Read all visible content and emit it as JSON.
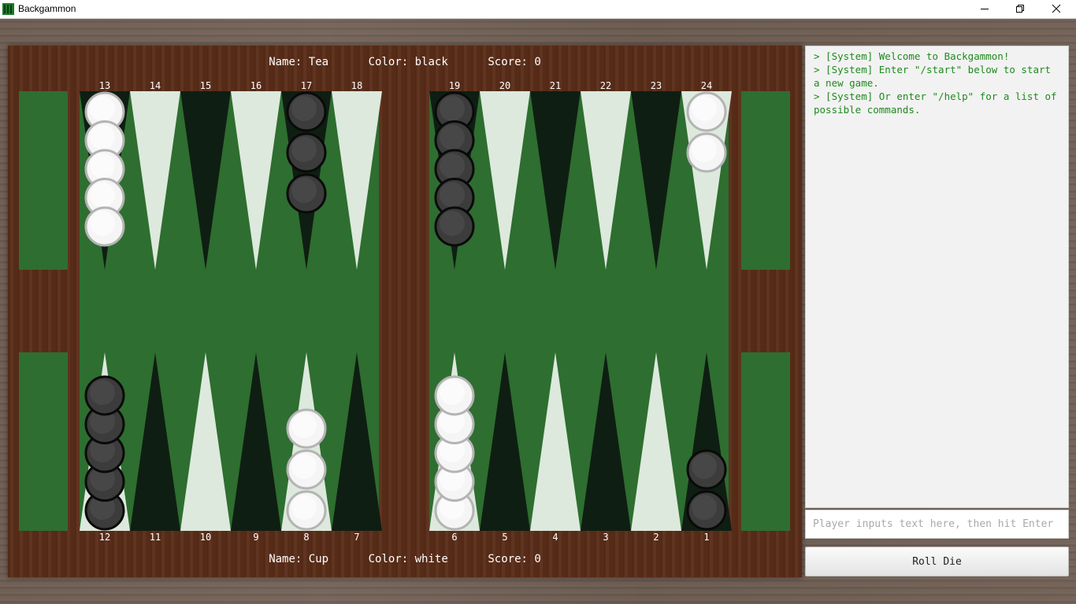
{
  "window": {
    "title": "Backgammon",
    "controls": [
      "minimize-icon",
      "restore-icon",
      "close-icon"
    ]
  },
  "players": {
    "top": {
      "name_text": "Name: Tea",
      "color_text": "Color: black",
      "score_text": "Score: 0"
    },
    "bottom": {
      "name_text": "Name: Cup",
      "color_text": "Color: white",
      "score_text": "Score: 0"
    }
  },
  "board": {
    "top_point_labels": [
      "13",
      "14",
      "15",
      "16",
      "17",
      "18",
      "19",
      "20",
      "21",
      "22",
      "23",
      "24"
    ],
    "bottom_point_labels": [
      "12",
      "11",
      "10",
      "9",
      "8",
      "7",
      "6",
      "5",
      "4",
      "3",
      "2",
      "1"
    ],
    "checkers": [
      {
        "point": 13,
        "color": "white",
        "count": 5
      },
      {
        "point": 17,
        "color": "black",
        "count": 3
      },
      {
        "point": 19,
        "color": "black",
        "count": 5
      },
      {
        "point": 24,
        "color": "white",
        "count": 2
      },
      {
        "point": 12,
        "color": "black",
        "count": 5
      },
      {
        "point": 8,
        "color": "white",
        "count": 3
      },
      {
        "point": 6,
        "color": "white",
        "count": 5
      },
      {
        "point": 1,
        "color": "black",
        "count": 2
      }
    ],
    "colors": {
      "felt": "#2e6e30",
      "wood": "#5a2d19",
      "light_point": "#dde9dd",
      "dark_point": "#0f1e12",
      "white_checker": "#f5f5f5",
      "black_checker": "#3c3c3c"
    }
  },
  "log": {
    "lines": [
      "> [System] Welcome to Backgammon!",
      "> [System] Enter \"/start\" below to start a new game.",
      "> [System] Or enter \"/help\" for a list of possible commands."
    ]
  },
  "input": {
    "placeholder": "Player inputs text here, then hit Enter",
    "value": ""
  },
  "roll_button": {
    "label": "Roll Die"
  }
}
